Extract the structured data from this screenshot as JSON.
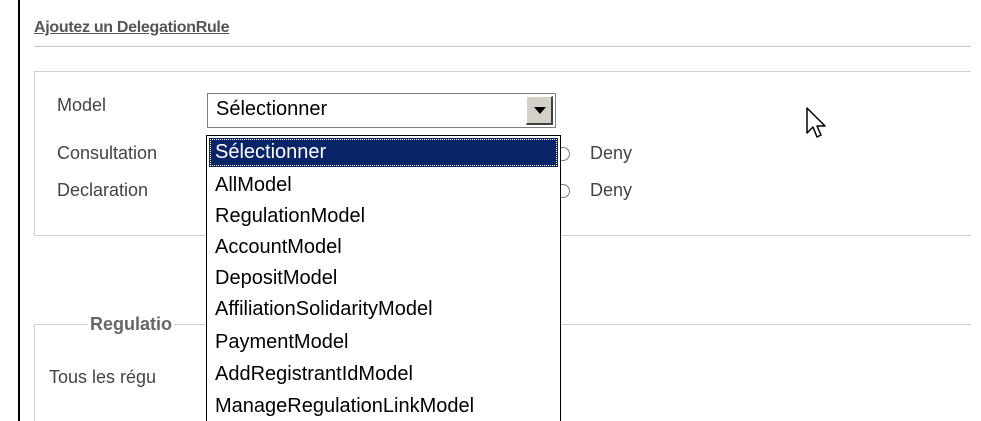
{
  "form": {
    "title": "Ajoutez un DelegationRule",
    "model_label": "Model",
    "consultation_label": "Consultation",
    "declaration_label": "Declaration",
    "deny_label": "Deny",
    "model_select": {
      "selected_value": "Sélectionner",
      "options": [
        "Sélectionner",
        "AllModel",
        "RegulationModel",
        "AccountModel",
        "DepositModel",
        "AffiliationSolidarityModel",
        "PaymentModel",
        "AddRegistrantIdModel",
        "ManageRegulationLinkModel"
      ],
      "highlighted_index": 0
    }
  },
  "regulation_section": {
    "legend": "Regulatio",
    "text": "Tous les régu"
  },
  "colors": {
    "highlight_bg": "#0a246a",
    "highlight_fg": "#ffffff",
    "label_text": "#444444"
  },
  "icons": {
    "dropdown_arrow": "chevron-down-icon",
    "cursor": "mouse-pointer-icon"
  }
}
